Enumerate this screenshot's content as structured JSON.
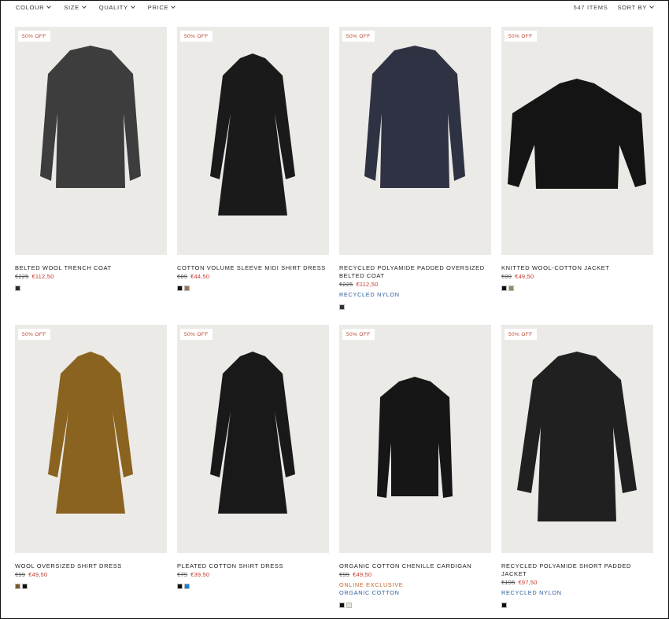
{
  "filters": [
    {
      "label": "COLOUR"
    },
    {
      "label": "SIZE"
    },
    {
      "label": "QUALITY"
    },
    {
      "label": "PRICE"
    }
  ],
  "item_count": "547 ITEMS",
  "sort_label": "SORT BY",
  "products": [
    {
      "badge": "50% OFF",
      "name": "BELTED WOOL TRENCH COAT",
      "old_price": "€225",
      "new_price": "€112,50",
      "tags": [],
      "swatches": [
        "#2a2a2a"
      ],
      "garment": "coat",
      "garment_color": "#3d3d3d"
    },
    {
      "badge": "50% OFF",
      "name": "COTTON VOLUME SLEEVE MIDI SHIRT DRESS",
      "old_price": "€89",
      "new_price": "€44,50",
      "tags": [],
      "swatches": [
        "#111111",
        "#a0734e"
      ],
      "garment": "dress",
      "garment_color": "#1a1a1a"
    },
    {
      "badge": "50% OFF",
      "name": "RECYCLED POLYAMIDE PADDED OVERSIZED BELTED COAT",
      "old_price": "€225",
      "new_price": "€112,50",
      "tags": [
        {
          "text": "RECYCLED NYLON",
          "color": "blue"
        }
      ],
      "swatches": [
        "#2c3040"
      ],
      "garment": "coat",
      "garment_color": "#2f3242"
    },
    {
      "badge": "50% OFF",
      "name": "KNITTED WOOL-COTTON JACKET",
      "old_price": "€99",
      "new_price": "€49,50",
      "tags": [],
      "swatches": [
        "#111111",
        "#8f8f6a"
      ],
      "garment": "jacket",
      "garment_color": "#141414"
    },
    {
      "badge": "50% OFF",
      "name": "WOOL OVERSIZED SHIRT DRESS",
      "old_price": "€99",
      "new_price": "€49,50",
      "tags": [],
      "swatches": [
        "#7a5a2a",
        "#111111"
      ],
      "garment": "dress",
      "garment_color": "#8a6320"
    },
    {
      "badge": "50% OFF",
      "name": "PLEATED COTTON SHIRT DRESS",
      "old_price": "€79",
      "new_price": "€39,50",
      "tags": [],
      "swatches": [
        "#111111",
        "#1c7fd6"
      ],
      "garment": "dress",
      "garment_color": "#191919"
    },
    {
      "badge": "50% OFF",
      "name": "ORGANIC COTTON CHENILLE CARDIGAN",
      "old_price": "€99",
      "new_price": "€49,50",
      "tags": [
        {
          "text": "ONLINE EXCLUSIVE",
          "color": "orange"
        },
        {
          "text": "ORGANIC COTTON",
          "color": "blue"
        }
      ],
      "swatches": [
        "#111111",
        "#e4e4d6"
      ],
      "garment": "cardigan",
      "garment_color": "#161616"
    },
    {
      "badge": "50% OFF",
      "name": "RECYCLED POLYAMIDE SHORT PADDED JACKET",
      "old_price": "€195",
      "new_price": "€97,50",
      "tags": [
        {
          "text": "RECYCLED NYLON",
          "color": "blue"
        }
      ],
      "swatches": [
        "#111111"
      ],
      "garment": "coat-short",
      "garment_color": "#202020"
    }
  ]
}
